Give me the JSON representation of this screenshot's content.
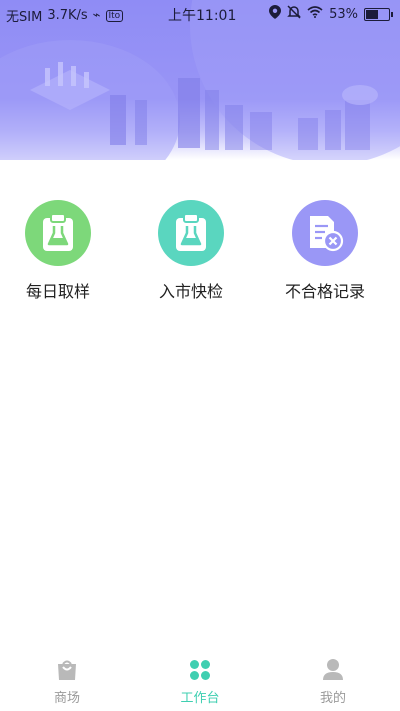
{
  "status_bar": {
    "carrier": "无SIM",
    "speed": "3.7K/s",
    "chip_text": "Ito",
    "time": "上午11:01",
    "battery": "53%",
    "battery_level": 0.53
  },
  "features": [
    {
      "label": "每日取样",
      "icon": "clipboard-flask-icon",
      "color": "#7dd87a"
    },
    {
      "label": "入市快检",
      "icon": "clipboard-flask-icon",
      "color": "#5ad6bf"
    },
    {
      "label": "不合格记录",
      "icon": "document-reject-icon",
      "color": "#9a97f6"
    }
  ],
  "tabbar": {
    "items": [
      {
        "label": "商场",
        "icon": "shopping-bag-icon",
        "active": false
      },
      {
        "label": "工作台",
        "icon": "clover-icon",
        "active": true
      },
      {
        "label": "我的",
        "icon": "person-icon",
        "active": false
      }
    ],
    "active_color": "#3fcfb1",
    "inactive_color": "#9a9a9a"
  },
  "colors": {
    "banner": "#8f8cf5"
  }
}
